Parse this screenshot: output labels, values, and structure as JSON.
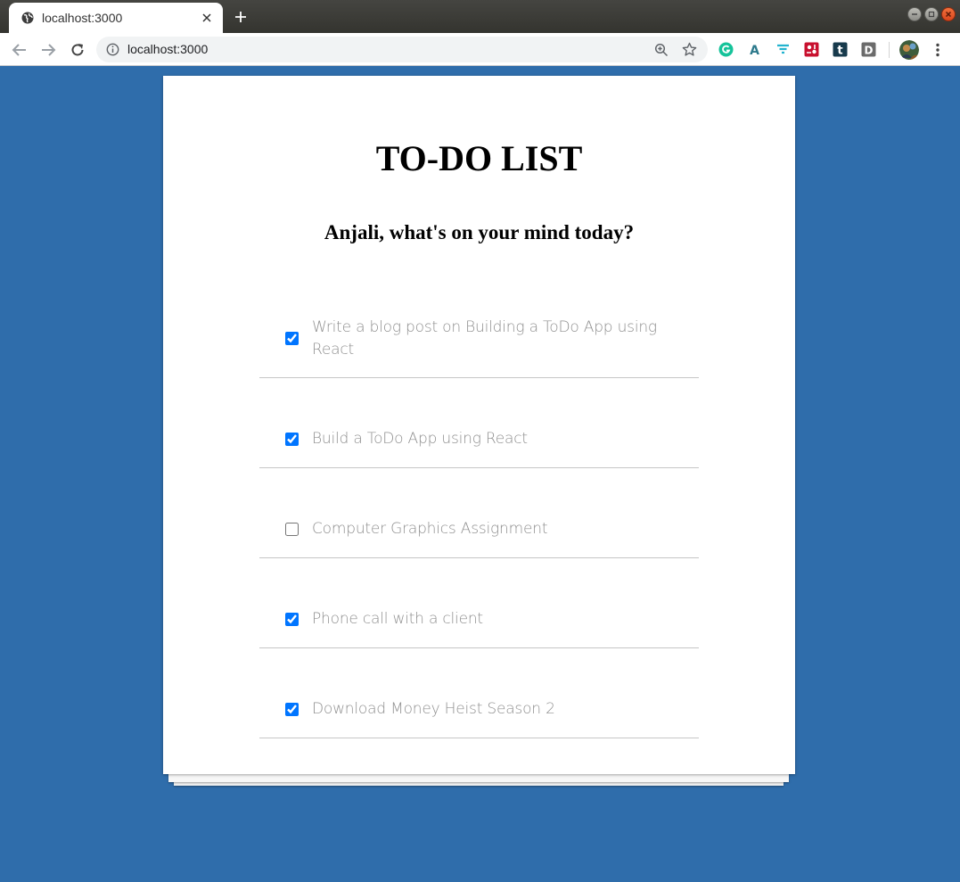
{
  "browser": {
    "tab_title": "localhost:3000",
    "url": "localhost:3000",
    "extensions": [
      "grammarly-icon",
      "a-icon",
      "filter-icon",
      "puzzle-icon",
      "tumblr-icon",
      "d-icon"
    ]
  },
  "app": {
    "title": "TO-DO LIST",
    "subtitle": "Anjali, what's on your mind today?",
    "todos": [
      {
        "text": "Write a blog post on Building a ToDo App using React",
        "done": true
      },
      {
        "text": "Build a ToDo App using React",
        "done": true
      },
      {
        "text": "Computer Graphics Assignment",
        "done": false
      },
      {
        "text": "Phone call with a client",
        "done": true
      },
      {
        "text": "Download Money Heist Season 2",
        "done": true
      }
    ]
  },
  "colors": {
    "background": "#2f6dab",
    "card": "#ffffff",
    "todo_text": "#8f8f8f"
  }
}
